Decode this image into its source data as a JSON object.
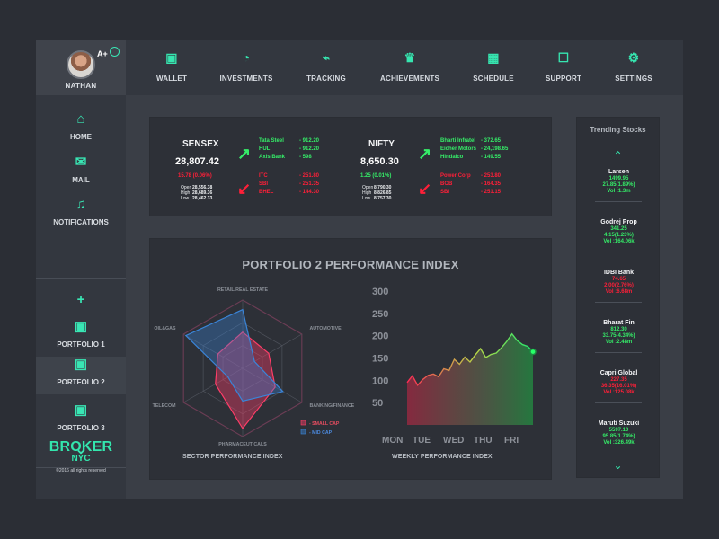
{
  "profile": {
    "name": "NATHAN",
    "badge": "A+",
    "award_icon": "award-icon"
  },
  "topnav": {
    "items": [
      {
        "label": "WALLET",
        "icon": "wallet-icon"
      },
      {
        "label": "INVESTMENTS",
        "icon": "pie-chart-icon"
      },
      {
        "label": "TRACKING",
        "icon": "line-chart-icon"
      },
      {
        "label": "ACHIEVEMENTS",
        "icon": "trophy-icon"
      },
      {
        "label": "SCHEDULE",
        "icon": "calendar-icon"
      },
      {
        "label": "SUPPORT",
        "icon": "chat-icon"
      },
      {
        "label": "SETTINGS",
        "icon": "gear-icon"
      }
    ]
  },
  "sidebar": {
    "items": [
      {
        "label": "HOME",
        "icon": "home-icon"
      },
      {
        "label": "MAIL",
        "icon": "mail-icon"
      },
      {
        "label": "NOTIFICATIONS",
        "icon": "bell-icon"
      },
      {
        "label": "",
        "icon": "plus-icon"
      },
      {
        "label": "PORTFOLIO 1",
        "icon": "briefcase-icon"
      },
      {
        "label": "PORTFOLIO 2",
        "icon": "briefcase-icon",
        "active": true
      },
      {
        "label": "PORTFOLIO 3",
        "icon": "briefcase-icon"
      },
      {
        "label": "",
        "icon": "chevron-down-icon"
      }
    ],
    "brand": {
      "title": "BROKER",
      "subtitle": "NYC",
      "copyright": "©2016 all rights reserved"
    }
  },
  "market": {
    "sensex": {
      "name": "SENSEX",
      "value": "28,807.42",
      "change": "15.78 (0.06%)",
      "open_label": "Open",
      "open": "28,556.38",
      "high_label": "High",
      "high": "28,689.36",
      "low_label": "Low",
      "low": "28,462.33",
      "gainers": [
        {
          "name": "Tata Steel",
          "value": "- 912.20"
        },
        {
          "name": "HUL",
          "value": "- 912.20"
        },
        {
          "name": "Axis Bank",
          "value": "- 598"
        }
      ],
      "losers": [
        {
          "name": "ITC",
          "value": "- 251.80"
        },
        {
          "name": "SBI",
          "value": "- 251.35"
        },
        {
          "name": "BHEL",
          "value": "- 144.30"
        }
      ]
    },
    "nifty": {
      "name": "NIFTY",
      "value": "8,650.30",
      "change": "1.25 (0.01%)",
      "open_label": "Open",
      "open": "8,790.30",
      "high_label": "High",
      "high": "8,826.85",
      "low_label": "Low",
      "low": "8,757.30",
      "gainers": [
        {
          "name": "Bharti Infratel",
          "value": "- 372.65"
        },
        {
          "name": "Eicher Motors",
          "value": "- 24,198.65"
        },
        {
          "name": "Hindalco",
          "value": "- 149.55"
        }
      ],
      "losers": [
        {
          "name": "Power Corp",
          "value": "- 253.80"
        },
        {
          "name": "BOB",
          "value": "- 164.35"
        },
        {
          "name": "SBI",
          "value": "- 251.15"
        }
      ]
    }
  },
  "performance": {
    "title": "PORTFOLIO 2 PERFORMANCE INDEX",
    "sector_caption": "SECTOR PERFORMANCE INDEX",
    "weekly_caption": "WEEKLY PERFORMANCE INDEX"
  },
  "chart_data": [
    {
      "type": "radar",
      "title": "SECTOR PERFORMANCE INDEX",
      "axes": [
        "RETAIL/REAL ESTATE",
        "AUTOMOTIVE",
        "BANKING/FINANCE",
        "PHARMACEUTICALS",
        "TELECOM",
        "OIL&GAS"
      ],
      "series": [
        {
          "name": "- SMALL CAP",
          "values": [
            0.53,
            0.44,
            0.55,
            0.88,
            0.46,
            0.42
          ],
          "color": "#ff3d68"
        },
        {
          "name": "- MID CAP",
          "values": [
            0.86,
            0.2,
            0.68,
            0.48,
            0.25,
            0.96
          ],
          "color": "#3a85d9"
        }
      ],
      "legend": "bottom-right"
    },
    {
      "type": "area",
      "title": "WEEKLY PERFORMANCE INDEX",
      "x": [
        "MON",
        "TUE",
        "WED",
        "THU",
        "FRI"
      ],
      "ylim": [
        0,
        300
      ],
      "yticks": [
        50,
        100,
        150,
        200,
        250,
        300
      ],
      "series": [
        {
          "values": [
            95,
            110,
            89,
            102,
            111,
            114,
            108,
            126,
            122,
            147,
            136,
            152,
            141,
            157,
            171,
            151,
            158,
            161,
            173,
            187,
            204,
            189,
            180,
            176,
            164
          ]
        }
      ]
    }
  ],
  "trending": {
    "title": "Trending Stocks",
    "items": [
      {
        "name": "Larsen",
        "price": "1499.95",
        "change": "27.85(1.89%)",
        "volume": "Vol :1.3m",
        "direction": "up"
      },
      {
        "name": "Godrej Prop",
        "price": "341.25",
        "change": "4.15(1.23%)",
        "volume": "Vol :164.06k",
        "direction": "up"
      },
      {
        "name": "IDBI Bank",
        "price": "74.65",
        "change": "2.00(2.76%)",
        "volume": "Vol :6.68m",
        "direction": "down"
      },
      {
        "name": "Bharat Fin",
        "price": "812.30",
        "change": "33.75(4.34%)",
        "volume": "Vol :2.48m",
        "direction": "up"
      },
      {
        "name": "Capri Global",
        "price": "227.35",
        "change": "36.35(16.01%)",
        "volume": "Vol :125.08k",
        "direction": "down"
      },
      {
        "name": "Maruti Suzuki",
        "price": "5597.10",
        "change": "95.85(1.74%)",
        "volume": "Vol :326.49k",
        "direction": "up"
      }
    ]
  },
  "colors": {
    "accent": "#35e6ad",
    "positive": "#35ec68",
    "negative": "#ff1f38"
  }
}
